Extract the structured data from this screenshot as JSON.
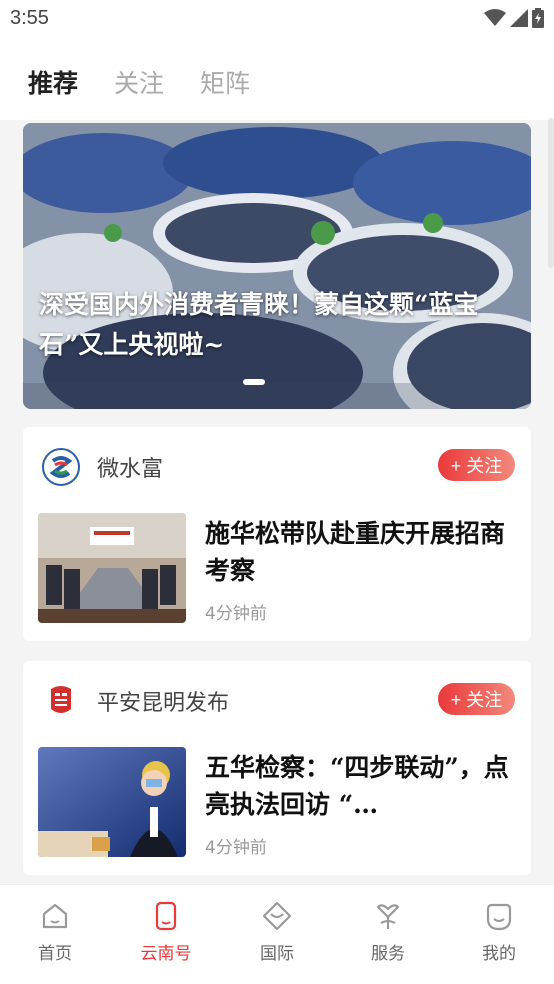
{
  "status_bar": {
    "time": "3:55"
  },
  "tabs": [
    {
      "label": "推荐",
      "active": true
    },
    {
      "label": "关注",
      "active": false
    },
    {
      "label": "矩阵",
      "active": false
    }
  ],
  "banner": {
    "title": "深受国内外消费者青睐！蒙自这颗“蓝宝石”又上央视啦~",
    "slide_index": 1,
    "slide_count": 4
  },
  "cards": [
    {
      "source": "微水富",
      "follow_label": "+ 关注",
      "title": "施华松带队赴重庆开展招商考察",
      "time": "4分钟前"
    },
    {
      "source": "平安昆明发布",
      "follow_label": "+ 关注",
      "title": "五华检察：“四步联动”，点亮执法回访 “…",
      "time": "4分钟前"
    }
  ],
  "bottom_nav": [
    {
      "label": "首页",
      "icon": "home-icon",
      "active": false
    },
    {
      "label": "云南号",
      "icon": "phone-icon",
      "active": true
    },
    {
      "label": "国际",
      "icon": "globe-tag-icon",
      "active": false
    },
    {
      "label": "服务",
      "icon": "service-icon",
      "active": false
    },
    {
      "label": "我的",
      "icon": "profile-icon",
      "active": false
    }
  ],
  "colors": {
    "accent": "#e9393a",
    "inactive": "#666666"
  }
}
